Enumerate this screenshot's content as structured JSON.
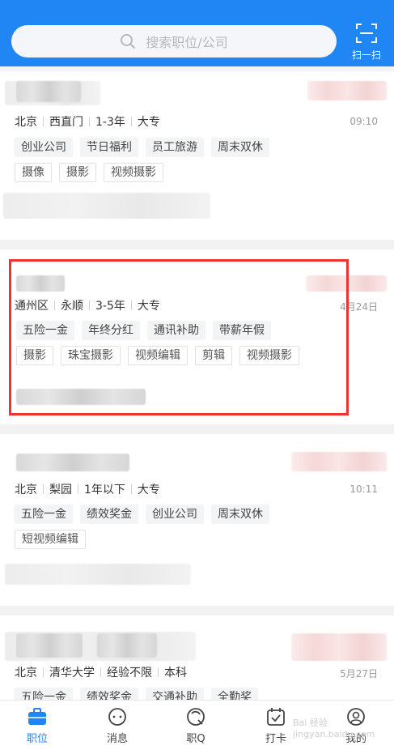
{
  "search": {
    "placeholder": "搜索职位/公司"
  },
  "scan": {
    "label": "扫一扫"
  },
  "jobs": [
    {
      "meta": [
        "北京",
        "西直门",
        "1-3年",
        "大专"
      ],
      "time": "09:10",
      "benefits": [
        "创业公司",
        "节日福利",
        "员工旅游",
        "周末双休"
      ],
      "skills": [
        "摄像",
        "摄影",
        "视频摄影"
      ]
    },
    {
      "meta": [
        "通州区",
        "永顺",
        "3-5年",
        "大专"
      ],
      "time": "4月24日",
      "benefits": [
        "五险一金",
        "年终分红",
        "通讯补助",
        "带薪年假"
      ],
      "skills": [
        "摄影",
        "珠宝摄影",
        "视频编辑",
        "剪辑",
        "视频摄影"
      ]
    },
    {
      "meta": [
        "北京",
        "梨园",
        "1年以下",
        "大专"
      ],
      "time": "10:11",
      "benefits": [
        "五险一金",
        "绩效奖金",
        "创业公司",
        "周末双休"
      ],
      "skills": [
        "短视频编辑"
      ]
    },
    {
      "meta": [
        "北京",
        "清华大学",
        "经验不限",
        "本科"
      ],
      "time": "5月27日",
      "benefits": [
        "五险一金",
        "绩效奖金",
        "交通补助",
        "全勤奖"
      ],
      "skills": []
    }
  ],
  "tabs": [
    {
      "label": "职位",
      "icon": "briefcase-icon",
      "active": true
    },
    {
      "label": "消息",
      "icon": "chat-icon",
      "active": false
    },
    {
      "label": "职Q",
      "icon": "q-icon",
      "active": false
    },
    {
      "label": "打卡",
      "icon": "checkin-icon",
      "active": false
    },
    {
      "label": "我的",
      "icon": "profile-icon",
      "active": false
    }
  ],
  "watermark": "Bai 经验 jingyan.baidu.com",
  "colors": {
    "brand": "#1f86f3",
    "highlight": "#ee3333"
  }
}
